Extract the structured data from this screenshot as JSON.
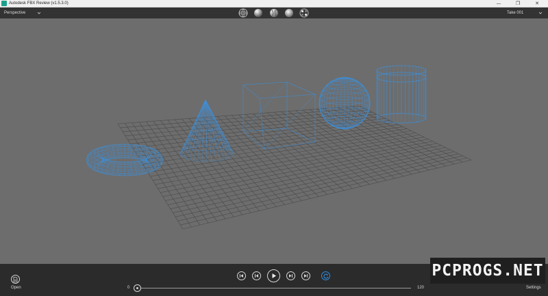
{
  "window": {
    "title": "Autodesk FBX Review (v1.5.3.0)",
    "minimize_glyph": "—",
    "restore_glyph": "❐",
    "close_glyph": "✕"
  },
  "toolbar": {
    "view_mode": "Perspective",
    "take": "Take 001",
    "shading_modes": [
      "wireframe-sphere-icon",
      "shaded-sphere-icon",
      "textured-sphere-icon",
      "lit-sphere-icon",
      "xray-sphere-icon"
    ]
  },
  "viewport": {
    "background": "#6d6d6d",
    "wire_color": "#3d8ed8",
    "grid_color": "#4a4a4a",
    "objects": [
      "torus",
      "cone",
      "cube",
      "sphere",
      "cylinder"
    ]
  },
  "playback": {
    "controls": [
      "skip-to-start-icon",
      "step-back-icon",
      "play-icon",
      "step-forward-icon",
      "skip-to-end-icon",
      "loop-icon"
    ],
    "loop_color": "#2f8ee6",
    "frame_start": "0",
    "frame_end": "120",
    "current_frame_fraction": 0.0
  },
  "footer": {
    "open_label": "Open",
    "settings_label": "Settings"
  },
  "watermark": "PCPROGS.NET"
}
